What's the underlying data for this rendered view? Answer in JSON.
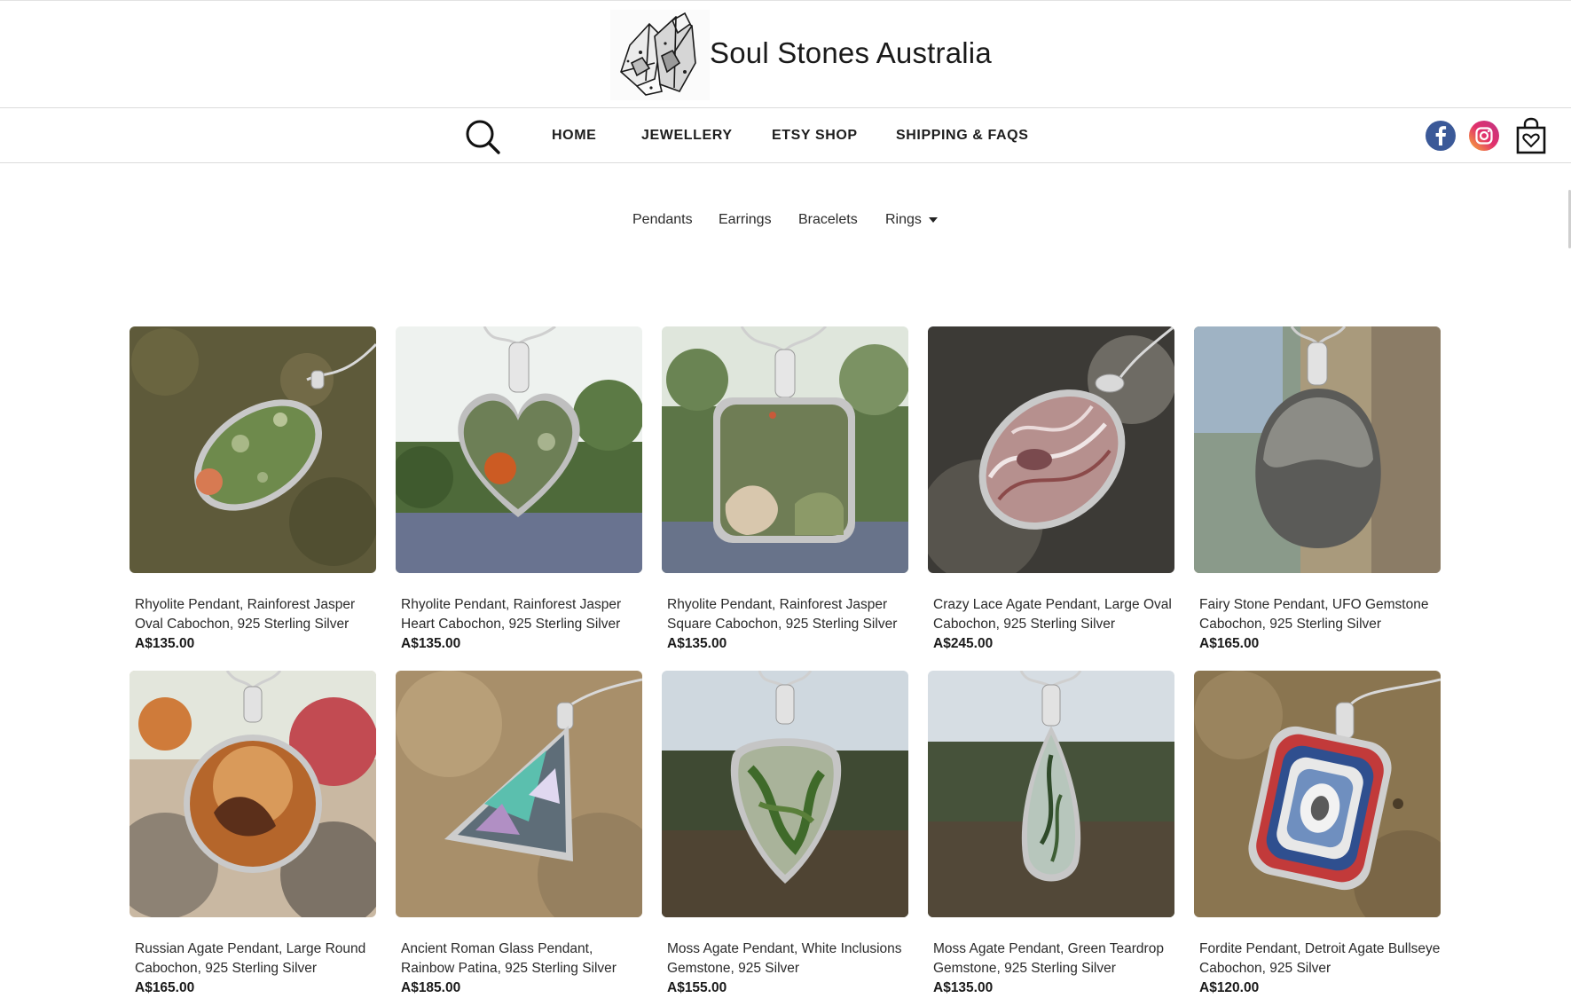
{
  "header": {
    "brand": "Soul Stones Australia"
  },
  "nav": {
    "items": [
      "HOME",
      "JEWELLERY",
      "ETSY SHOP",
      "SHIPPING & FAQS"
    ],
    "icons": [
      "search-icon",
      "facebook-icon",
      "instagram-icon",
      "shopping-bag-icon"
    ]
  },
  "subnav": {
    "items": [
      "Pendants",
      "Earrings",
      "Bracelets",
      "Rings"
    ]
  },
  "colors": {
    "facebook": "#3b5998",
    "instagram_start": "#f9b233",
    "instagram_end": "#c13584"
  },
  "products": [
    {
      "title": "Rhyolite Pendant, Rainforest Jasper Oval Cabochon, 925 Sterling Silver",
      "price": "A$135.00"
    },
    {
      "title": "Rhyolite Pendant, Rainforest Jasper Heart Cabochon, 925 Sterling Silver",
      "price": "A$135.00"
    },
    {
      "title": "Rhyolite Pendant, Rainforest Jasper Square Cabochon, 925 Sterling Silver",
      "price": "A$135.00"
    },
    {
      "title": "Crazy Lace Agate Pendant, Large Oval Cabochon, 925 Sterling Silver",
      "price": "A$245.00"
    },
    {
      "title": "Fairy Stone Pendant, UFO Gemstone Cabochon, 925 Sterling Silver",
      "price": "A$165.00"
    },
    {
      "title": "Russian Agate Pendant, Large Round Cabochon, 925 Sterling Silver",
      "price": "A$165.00"
    },
    {
      "title": "Ancient Roman Glass Pendant, Rainbow Patina, 925 Sterling Silver",
      "price": "A$185.00"
    },
    {
      "title": "Moss Agate Pendant, White Inclusions Gemstone, 925 Silver",
      "price": "A$155.00"
    },
    {
      "title": "Moss Agate Pendant, Green Teardrop Gemstone, 925 Sterling Silver",
      "price": "A$135.00"
    },
    {
      "title": "Fordite Pendant, Detroit Agate Bullseye Cabochon, 925 Silver",
      "price": "A$120.00"
    }
  ]
}
